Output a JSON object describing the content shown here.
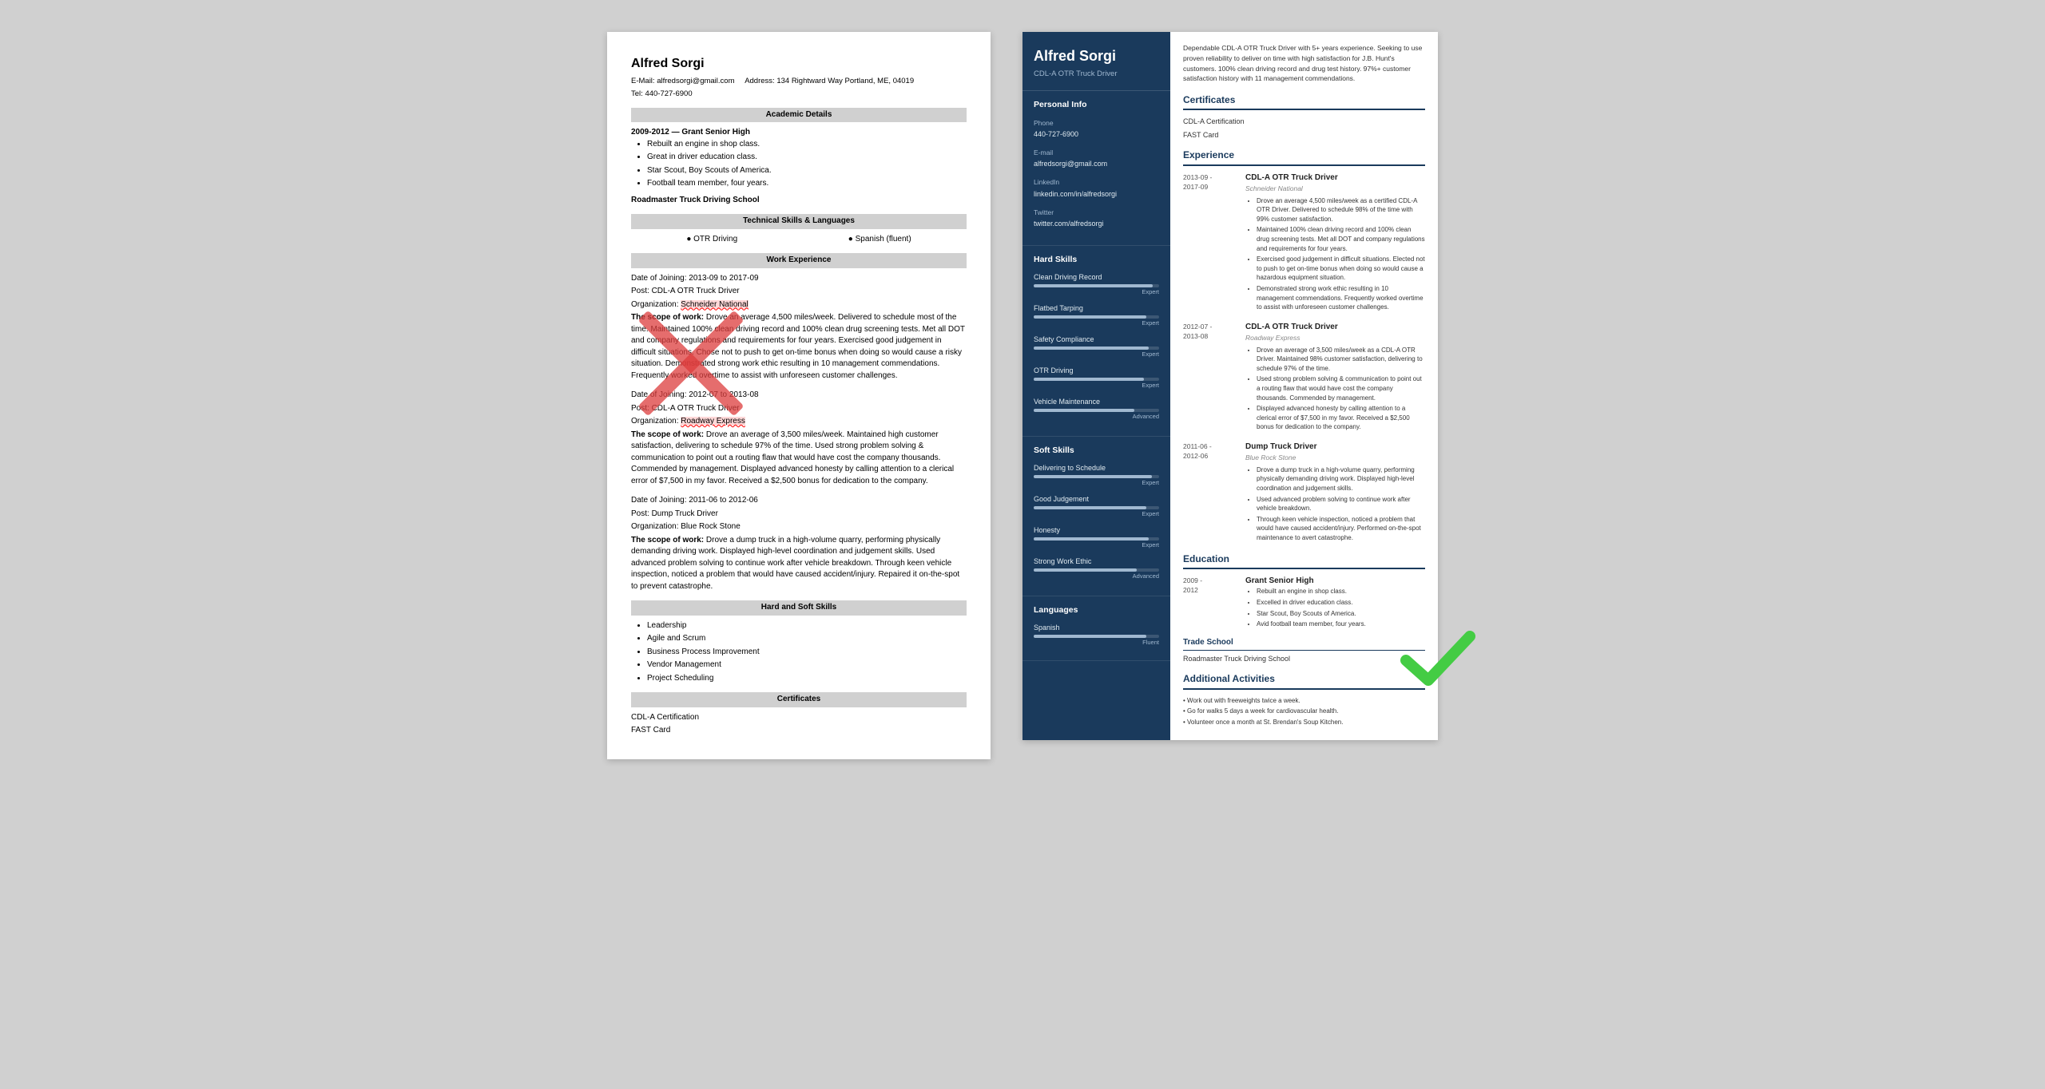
{
  "left_resume": {
    "name": "Alfred Sorgi",
    "email_label": "E-Mail:",
    "email": "alfredsorgi@gmail.com",
    "address_label": "Address:",
    "address": "134 Rightward Way Portland, ME, 04019",
    "tel_label": "Tel:",
    "tel": "440-727-6900",
    "sections": {
      "academic": {
        "title": "Academic Details",
        "entries": [
          {
            "years": "2009-2012",
            "school": "Grant Senior High",
            "bullets": [
              "Rebuilt an engine in shop class.",
              "Great in driver education class.",
              "Star Scout, Boy Scouts of America.",
              "Football team member, four years."
            ]
          }
        ],
        "driving_school": "Roadmaster Truck Driving School"
      },
      "technical": {
        "title": "Technical Skills & Languages",
        "skills": [
          "OTR Driving",
          "Spanish (fluent)"
        ]
      },
      "work": {
        "title": "Work Experience",
        "entries": [
          {
            "date_label": "Date of Joining:",
            "date": "2013-09 to 2017-09",
            "post_label": "Post:",
            "post": "CDL-A OTR Truck Driver",
            "org_label": "Organization:",
            "org": "Schneider National",
            "scope_label": "The scope of work:",
            "scope": "Drove an average 4,500 miles/week. Delivered to schedule most of the time. Maintained 100% clean driving record and 100% clean drug screening tests. Met all DOT and company regulations and requirements for four years. Exercised good judgement in difficult situations. Chose not to push to get on-time bonus when doing so would cause a risky situation. Demonstrated strong work ethic resulting in 10 management commendations. Frequently worked overtime to assist with unforeseen customer challenges."
          },
          {
            "date_label": "Date of Joining:",
            "date": "2012-07 to 2013-08",
            "post_label": "Post:",
            "post": "CDL-A OTR Truck Driver",
            "org_label": "Organization:",
            "org": "Roadway Express",
            "scope_label": "The scope of work:",
            "scope": "Drove an average of 3,500 miles/week. Maintained high customer satisfaction, delivering to schedule 97% of the time. Used strong problem solving & communication to point out a routing flaw that would have cost the company thousands. Commended by management. Displayed advanced honesty by calling attention to a clerical error of $7,500 in my favor. Received a $2,500 bonus for dedication to the company."
          },
          {
            "date_label": "Date of Joining:",
            "date": "2011-06 to 2012-06",
            "post_label": "Post:",
            "post": "Dump Truck Driver",
            "org_label": "Organization:",
            "org": "Blue Rock Stone",
            "scope_label": "The scope of work:",
            "scope": "Drove a dump truck in a high-volume quarry, performing physically demanding driving work. Displayed high-level coordination and judgement skills. Used advanced problem solving to continue work after vehicle breakdown. Through keen vehicle inspection, noticed a problem that would have caused accident/injury. Repaired it on-the-spot to prevent catastrophe."
          }
        ]
      },
      "hard_soft": {
        "title": "Hard and Soft Skills",
        "skills": [
          "Leadership",
          "Agile and Scrum",
          "Business Process Improvement",
          "Vendor Management",
          "Project Scheduling"
        ]
      },
      "certificates": {
        "title": "Certificates",
        "items": [
          "CDL-A Certification",
          "FAST Card"
        ]
      }
    }
  },
  "right_resume": {
    "name": "Alfred Sorgi",
    "title": "CDL-A OTR Truck Driver",
    "summary": "Dependable CDL-A OTR Truck Driver with 5+ years experience. Seeking to use proven reliability to deliver on time with high satisfaction for J.B. Hunt's customers. 100% clean driving record and drug test history. 97%+ customer satisfaction history with 11 management commendations.",
    "sidebar": {
      "personal_info_title": "Personal Info",
      "phone_label": "Phone",
      "phone": "440-727-6900",
      "email_label": "E-mail",
      "email": "alfredsorgi@gmail.com",
      "linkedin_label": "LinkedIn",
      "linkedin": "linkedin.com/in/alfredsorgi",
      "twitter_label": "Twitter",
      "twitter": "twitter.com/alfredsorgi",
      "hard_skills_title": "Hard Skills",
      "hard_skills": [
        {
          "name": "Clean Driving Record",
          "pct": 95,
          "level": "Expert"
        },
        {
          "name": "Flatbed Tarping",
          "pct": 90,
          "level": "Expert"
        },
        {
          "name": "Safety Compliance",
          "pct": 92,
          "level": "Expert"
        },
        {
          "name": "OTR Driving",
          "pct": 88,
          "level": "Expert"
        },
        {
          "name": "Vehicle Maintenance",
          "pct": 80,
          "level": "Advanced"
        }
      ],
      "soft_skills_title": "Soft Skills",
      "soft_skills": [
        {
          "name": "Delivering to Schedule",
          "pct": 94,
          "level": "Expert"
        },
        {
          "name": "Good Judgement",
          "pct": 90,
          "level": "Expert"
        },
        {
          "name": "Honesty",
          "pct": 92,
          "level": "Expert"
        },
        {
          "name": "Strong Work Ethic",
          "pct": 82,
          "level": "Advanced"
        }
      ],
      "languages_title": "Languages",
      "languages": [
        {
          "name": "Spanish",
          "pct": 90,
          "level": "Fluent"
        }
      ]
    },
    "certificates": {
      "title": "Certificates",
      "items": [
        "CDL-A Certification",
        "FAST Card"
      ]
    },
    "experience": {
      "title": "Experience",
      "entries": [
        {
          "dates": "2013-09 -\n2017-09",
          "job_title": "CDL-A OTR Truck Driver",
          "company": "Schneider National",
          "bullets": [
            "Drove an average 4,500 miles/week as a certified CDL-A OTR Driver. Delivered to schedule 98% of the time with 99% customer satisfaction.",
            "Maintained 100% clean driving record and 100% clean drug screening tests. Met all DOT and company regulations and requirements for four years.",
            "Exercised good judgement in difficult situations. Elected not to push to get on-time bonus when doing so would cause a hazardous equipment situation.",
            "Demonstrated strong work ethic resulting in 10 management commendations. Frequently worked overtime to assist with unforeseen customer challenges."
          ]
        },
        {
          "dates": "2012-07 -\n2013-08",
          "job_title": "CDL-A OTR Truck Driver",
          "company": "Roadway Express",
          "bullets": [
            "Drove an average of 3,500 miles/week as a CDL-A OTR Driver. Maintained 98% customer satisfaction, delivering to schedule 97% of the time.",
            "Used strong problem solving & communication to point out a routing flaw that would have cost the company thousands. Commended by management.",
            "Displayed advanced honesty by calling attention to a clerical error of $7,500 in my favor. Received a $2,500 bonus for dedication to the company."
          ]
        },
        {
          "dates": "2011-06 -\n2012-06",
          "job_title": "Dump Truck Driver",
          "company": "Blue Rock Stone",
          "bullets": [
            "Drove a dump truck in a high-volume quarry, performing physically demanding driving work. Displayed high-level coordination and judgement skills.",
            "Used advanced problem solving to continue work after vehicle breakdown.",
            "Through keen vehicle inspection, noticed a problem that would have caused accident/injury. Performed on-the-spot maintenance to avert catastrophe."
          ]
        }
      ]
    },
    "education": {
      "title": "Education",
      "entries": [
        {
          "dates": "2009 -\n2012",
          "school": "Grant Senior High",
          "bullets": [
            "Rebuilt an engine in shop class.",
            "Excelled in driver education class.",
            "Star Scout, Boy Scouts of America.",
            "Avid football team member, four years."
          ]
        }
      ],
      "trade_school_label": "Trade School",
      "trade_school": "Roadmaster Truck Driving School"
    },
    "additional": {
      "title": "Additional Activities",
      "items": [
        "Work out with freeweights twice a week.",
        "Go for walks 5 days a week for cardiovascular health.",
        "Volunteer once a month at St. Brendan's Soup Kitchen."
      ]
    }
  }
}
